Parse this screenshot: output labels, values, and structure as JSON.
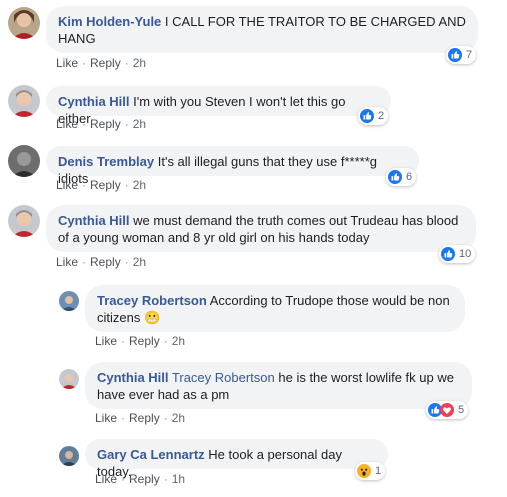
{
  "colors": {
    "link": "#385898",
    "like": "#1877f2",
    "love": "#f33e58",
    "wow": "#f7b125",
    "bubble": "#f2f3f5"
  },
  "actions": {
    "like": "Like",
    "reply": "Reply",
    "separator": "·"
  },
  "comments": [
    {
      "author": "Kim Holden-Yule",
      "text": "I CALL FOR THE TRAITOR TO BE CHARGED AND HANG",
      "time": "2h",
      "reaction_count": "7",
      "reactions": [
        "like-icon"
      ]
    },
    {
      "author": "Cynthia Hill",
      "text": "I'm with you Steven I won't let this go either",
      "time": "2h",
      "reaction_count": "2",
      "reactions": [
        "like-icon"
      ]
    },
    {
      "author": "Denis Tremblay",
      "text": "It's all illegal guns that they use f*****g idiots",
      "time": "2h",
      "reaction_count": "6",
      "reactions": [
        "like-icon"
      ]
    },
    {
      "author": "Cynthia Hill",
      "text": "we must demand the truth comes out Trudeau has blood of a young woman and 8 yr old girl on his hands today",
      "time": "2h",
      "reaction_count": "10",
      "reactions": [
        "like-icon"
      ]
    }
  ],
  "replies": [
    {
      "author": "Tracey Robertson",
      "text": "According to Trudope those would be non citizens",
      "emoji": "😬",
      "time": "2h"
    },
    {
      "author": "Cynthia Hill",
      "mention": "Tracey Robertson",
      "text": "he is the worst lowlife fk up we have ever had as a pm",
      "time": "2h",
      "reaction_count": "5",
      "reactions": [
        "like-icon",
        "love-icon"
      ]
    },
    {
      "author": "Gary Ca Lennartz",
      "text": "He took a personal day today.",
      "time": "1h",
      "reaction_count": "1",
      "reactions": [
        "wow-icon"
      ]
    }
  ]
}
